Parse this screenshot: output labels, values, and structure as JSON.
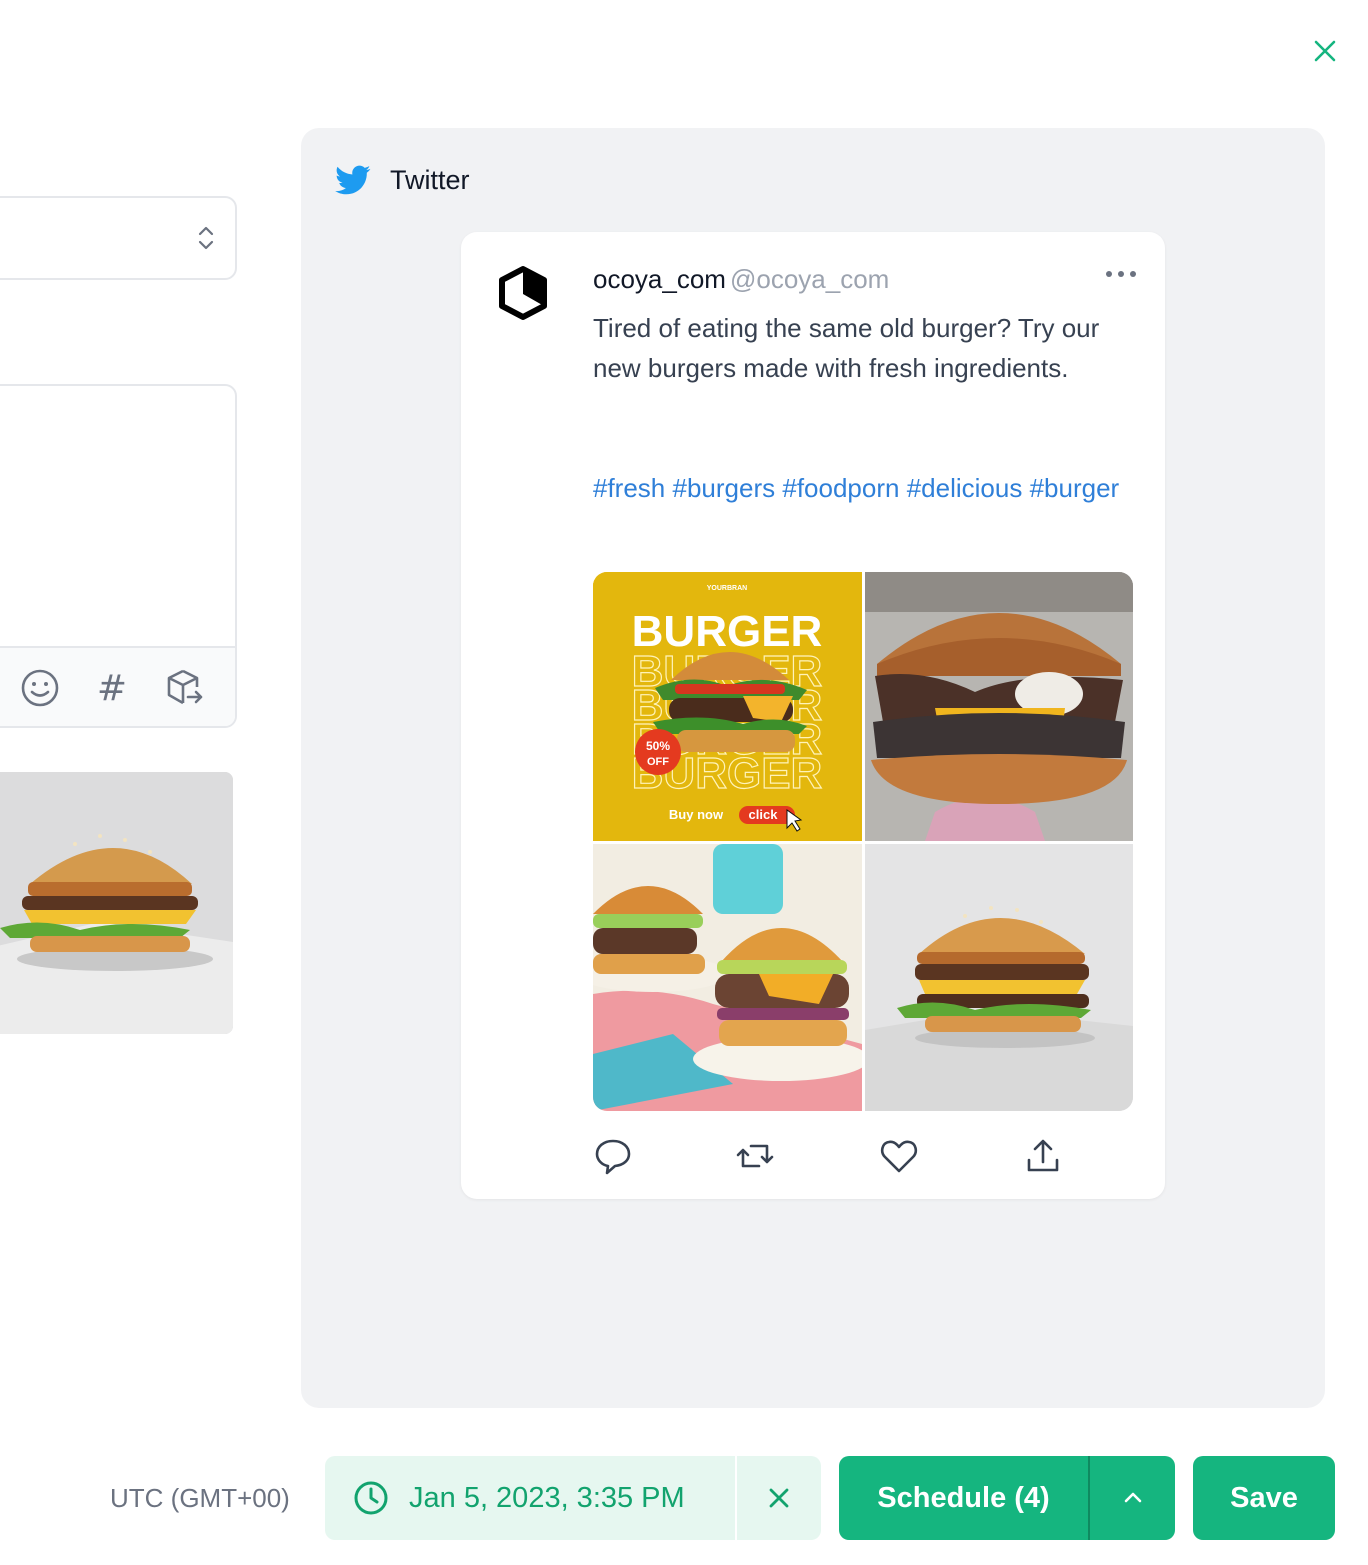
{
  "modal": {
    "close_icon": "close-icon"
  },
  "editor": {
    "select_icon": "chevron-up-down-icon",
    "toolbar": [
      "emoji-icon",
      "hashtag-icon",
      "library-export-icon"
    ],
    "hash_glyph": "#"
  },
  "preview": {
    "platform": "Twitter",
    "platform_icon": "twitter-icon",
    "tweet": {
      "name": "ocoya_com",
      "handle": "@ocoya_com",
      "text": "Tired of eating the same old burger? Try our new burgers made with fresh ingredients.",
      "hashtags": [
        "#fresh",
        "#burgers",
        "#foodporn",
        "#delicious",
        "#burger"
      ],
      "promo": {
        "brand": "YOURBRAN",
        "headline": "BURGER",
        "badge_top": "50%",
        "badge_bottom": "OFF",
        "cta": "Buy now",
        "cta_click": "click"
      },
      "actions": [
        "reply-icon",
        "retweet-icon",
        "like-icon",
        "share-icon"
      ]
    }
  },
  "footer": {
    "timezone": "UTC (GMT+00)",
    "datetime": "Jan 5, 2023, 3:35 PM",
    "schedule_label": "Schedule (4)",
    "save_label": "Save"
  },
  "colors": {
    "accent": "#15b57f",
    "accent_light": "#e6f7f0",
    "hashtag": "#2f7fd8",
    "twitter": "#1d9bf0"
  }
}
